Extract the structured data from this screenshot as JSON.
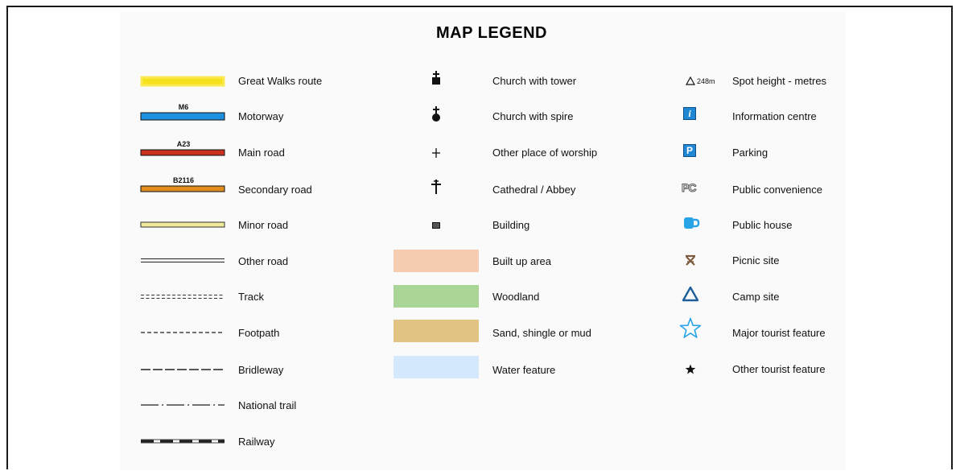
{
  "title": "MAP LEGEND",
  "colors": {
    "great_walks": "#f5e011",
    "motorway": "#1e90e0",
    "main_road": "#c8321e",
    "secondary_road": "#e08c1e",
    "minor_road": "#f0ea9a",
    "built_up_area": "#f6cdb1",
    "woodland": "#a9d596",
    "sand": "#e1c384",
    "water": "#d4e9fb",
    "info_blue": "#1f87d4",
    "pub_blue": "#27a3e8",
    "camp_blue": "#1e5f9a",
    "picnic_brown": "#7a5a3a"
  },
  "column1": {
    "great_walks": "Great Walks route",
    "motorway": "Motorway",
    "motorway_code": "M6",
    "main_road": "Main road",
    "main_road_code": "A23",
    "secondary_road": "Secondary road",
    "secondary_road_code": "B2116",
    "minor_road": "Minor road",
    "other_road": "Other road",
    "track": "Track",
    "footpath": "Footpath",
    "bridleway": "Bridleway",
    "national_trail": "National trail",
    "railway": "Railway"
  },
  "column2": {
    "church_tower": "Church with tower",
    "church_spire": "Church with spire",
    "other_worship": "Other place of worship",
    "cathedral": "Cathedral / Abbey",
    "building": "Building",
    "built_up": "Built up area",
    "woodland": "Woodland",
    "sand": "Sand, shingle or mud",
    "water": "Water feature"
  },
  "column3": {
    "spot_height": "Spot height - metres",
    "spot_height_sample": "248m",
    "info_centre": "Information centre",
    "info_glyph": "i",
    "parking": "Parking",
    "parking_glyph": "P",
    "public_convenience": "Public convenience",
    "pc_glyph": "PC",
    "public_house": "Public house",
    "picnic": "Picnic site",
    "camp": "Camp site",
    "major_tourist": "Major tourist feature",
    "other_tourist": "Other tourist feature"
  }
}
